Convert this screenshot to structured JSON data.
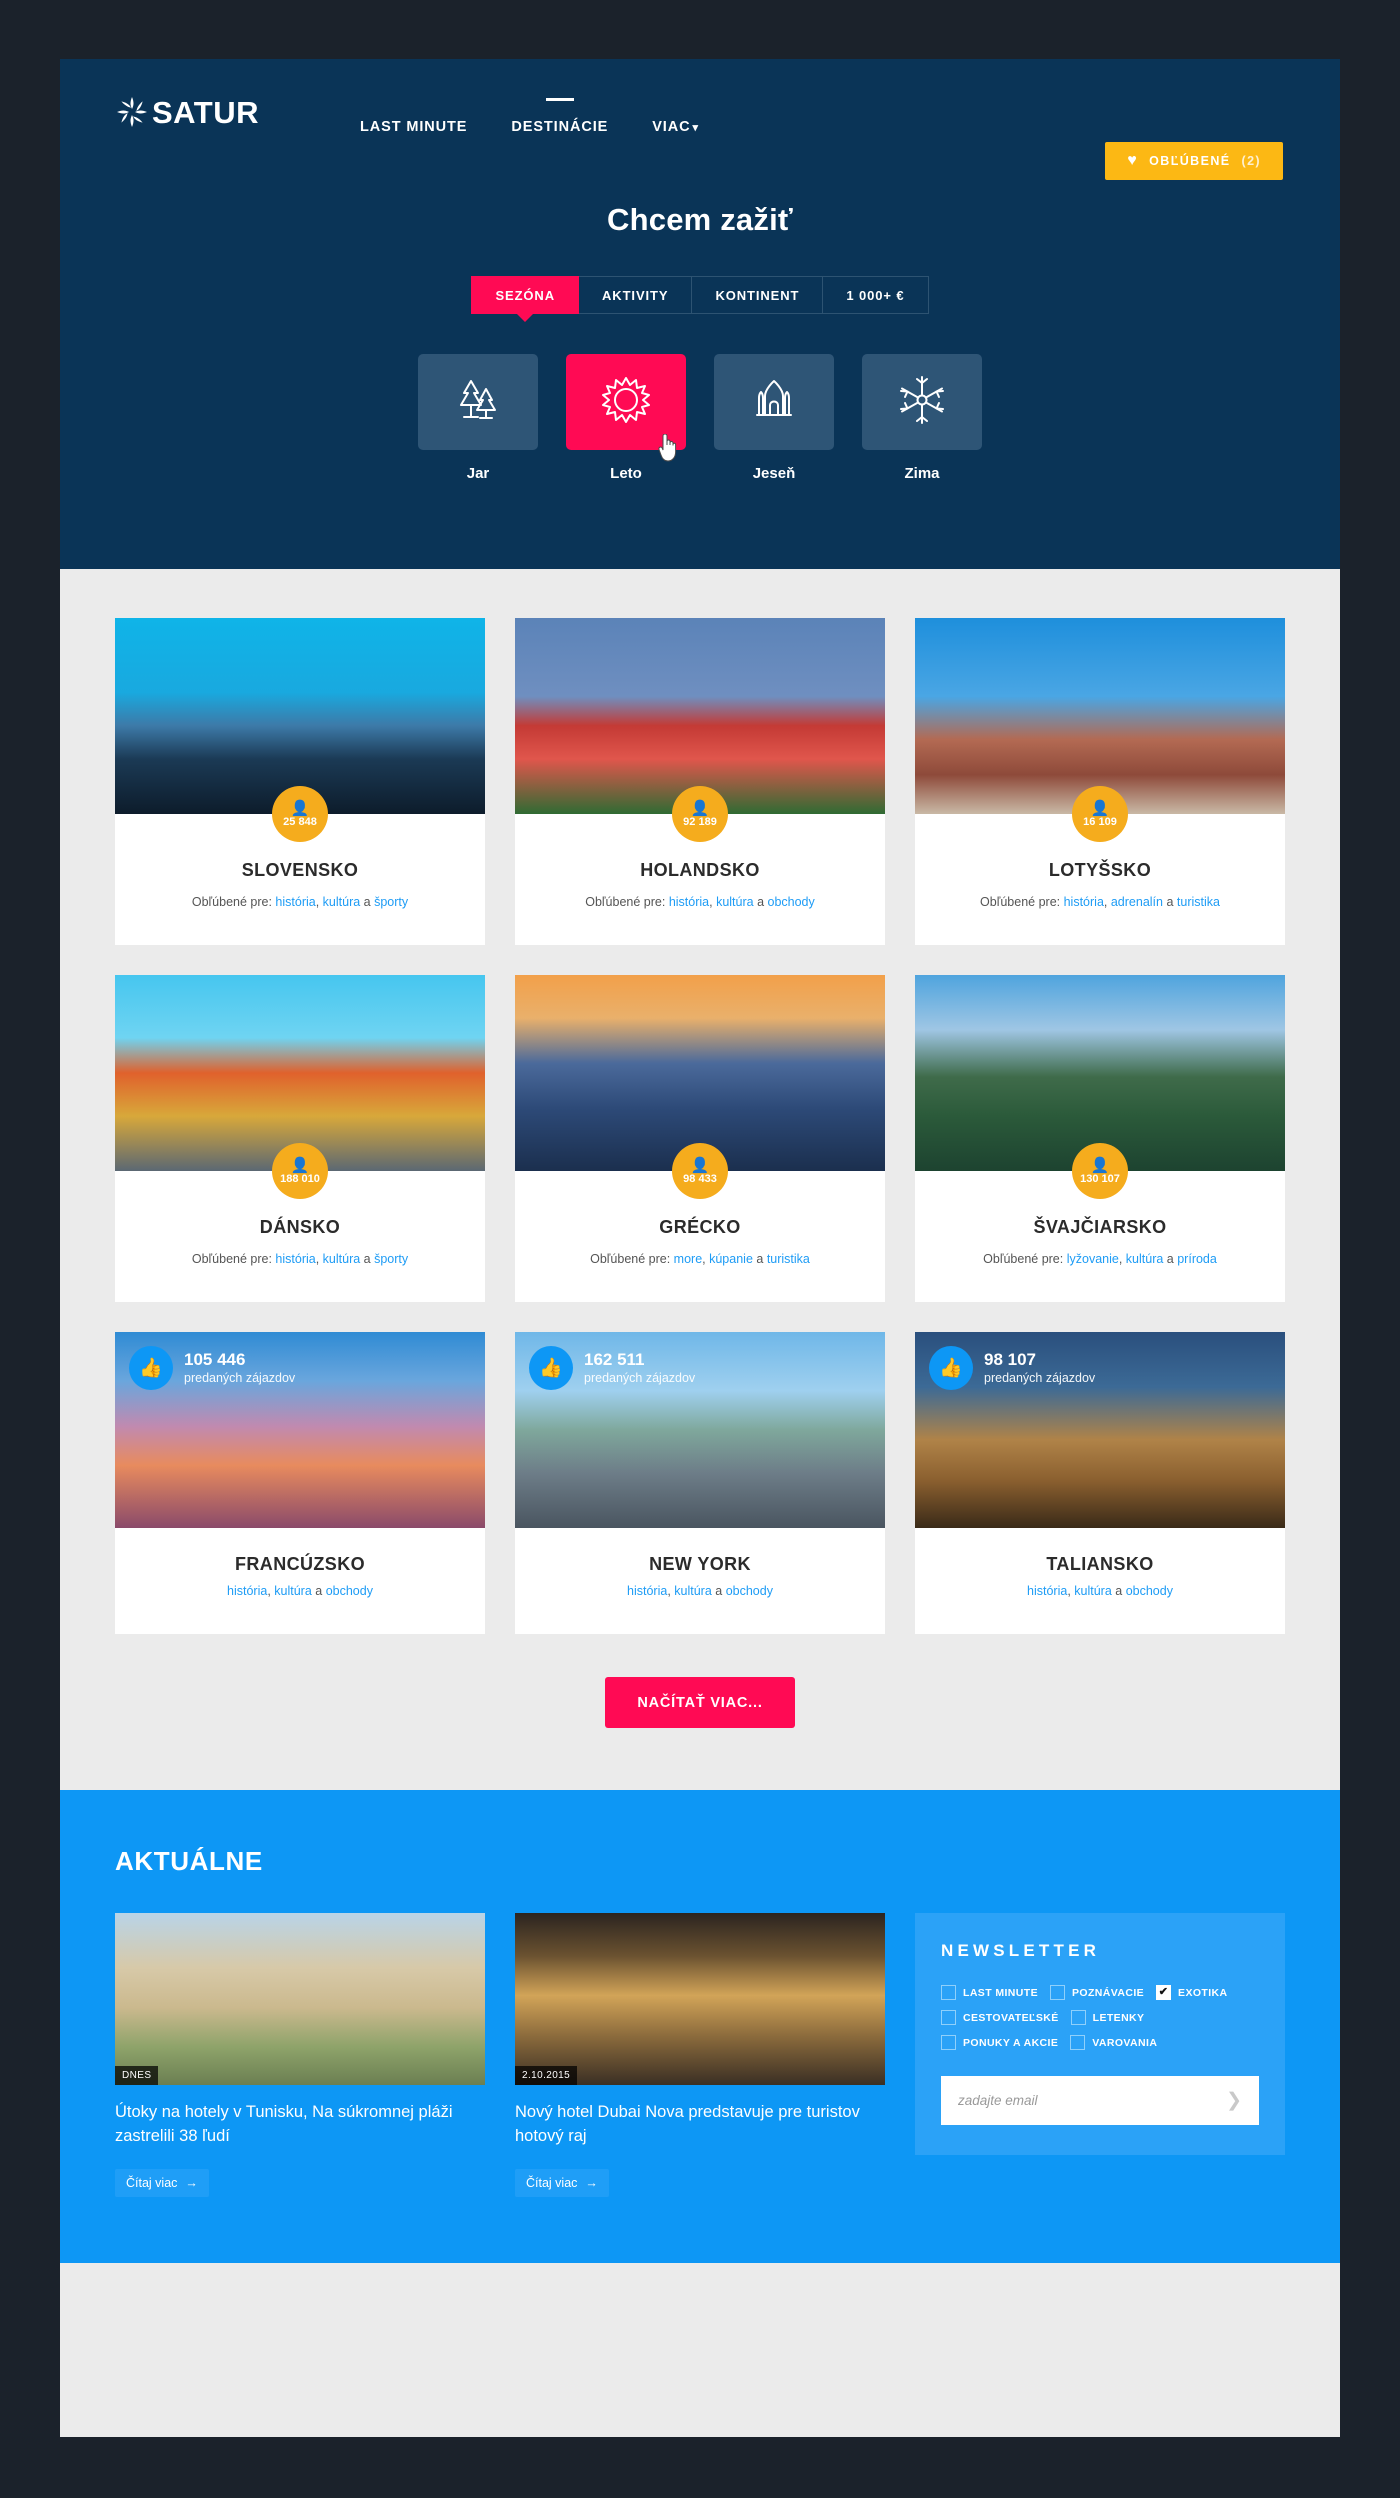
{
  "header": {
    "brand": "SATUR",
    "nav": [
      {
        "label": "LAST MINUTE",
        "active": false
      },
      {
        "label": "DESTINÁCIE",
        "active": true
      },
      {
        "label": "VIAC",
        "active": false,
        "caret": "⌄"
      }
    ],
    "favorites": {
      "label": "OBĽÚBENÉ",
      "count": "(2)",
      "icon": "heart-icon",
      "color": "#fcb814"
    }
  },
  "hero": {
    "title": "Chcem zažiť",
    "bg_color": "#0a3457",
    "accent_color": "#ff0a54",
    "tabs": [
      {
        "label": "SEZÓNA",
        "active": true
      },
      {
        "label": "AKTIVITY",
        "active": false
      },
      {
        "label": "KONTINENT",
        "active": false
      },
      {
        "label": "1 000+ €",
        "active": false
      }
    ],
    "seasons": [
      {
        "label": "Jar",
        "icon": "trees-icon",
        "active": false
      },
      {
        "label": "Leto",
        "icon": "sun-icon",
        "active": true
      },
      {
        "label": "Jeseň",
        "icon": "mosque-icon",
        "active": false
      },
      {
        "label": "Zima",
        "icon": "snowflake-icon",
        "active": false
      }
    ]
  },
  "destinations": [
    {
      "name": "SLOVENSKO",
      "badge_type": "people",
      "count": "25 848",
      "prefix": "Obľúbené pre: ",
      "tags": [
        "história",
        "kultúra",
        "športy"
      ],
      "img": "bratislava-castle"
    },
    {
      "name": "HOLANDSKO",
      "badge_type": "people",
      "count": "92 189",
      "prefix": "Obľúbené pre: ",
      "tags": [
        "história",
        "kultúra",
        "obchody"
      ],
      "img": "windmill-tulips"
    },
    {
      "name": "LOTYŠSKO",
      "badge_type": "people",
      "count": "16 109",
      "prefix": "Obľúbené pre: ",
      "tags": [
        "história",
        "adrenalín",
        "turistika"
      ],
      "img": "riga-houses"
    },
    {
      "name": "DÁNSKO",
      "badge_type": "people",
      "count": "188 010",
      "prefix": "Obľúbené pre: ",
      "tags": [
        "história",
        "kultúra",
        "športy"
      ],
      "img": "nyhavn-copenhagen"
    },
    {
      "name": "GRÉCKO",
      "badge_type": "people",
      "count": "98 433",
      "prefix": "Obľúbené pre: ",
      "tags": [
        "more",
        "kúpanie",
        "turistika"
      ],
      "img": "santorini-sunset"
    },
    {
      "name": "ŠVAJČIARSKO",
      "badge_type": "people",
      "count": "130 107",
      "prefix": "Obľúbené pre: ",
      "tags": [
        "lyžovanie",
        "kultúra",
        "príroda"
      ],
      "img": "mountain-lake"
    },
    {
      "name": "FRANCÚZSKO",
      "badge_type": "likes",
      "count": "105 446",
      "count_label": "predaných zájazdov",
      "prefix": "",
      "tags": [
        "história",
        "kultúra",
        "obchody"
      ],
      "img": "eiffel-tower-sunset"
    },
    {
      "name": "NEW YORK",
      "badge_type": "likes",
      "count": "162 511",
      "count_label": "predaných zájazdov",
      "prefix": "",
      "tags": [
        "história",
        "kultúra",
        "obchody"
      ],
      "img": "statue-of-liberty"
    },
    {
      "name": "TALIANSKO",
      "badge_type": "likes",
      "count": "98 107",
      "count_label": "predaných zájazdov",
      "prefix": "",
      "tags": [
        "história",
        "kultúra",
        "obchody"
      ],
      "img": "colosseum-night"
    }
  ],
  "load_more": {
    "label": "NAČÍTAŤ VIAC..."
  },
  "news": {
    "title": "AKTUÁLNE",
    "bg_color": "#0d97f5",
    "articles": [
      {
        "date": "DNES",
        "headline": "Útoky na hotely v Tunisku, Na súkromnej pláži zastrelili 38 ľudí",
        "read_more": "Čítaj viac",
        "img": "tunisia-hotel"
      },
      {
        "date": "2.10.2015",
        "headline": "Nový hotel Dubai Nova predstavuje pre turistov hotový raj",
        "read_more": "Čítaj viac",
        "img": "dubai-hotel-interior"
      }
    ],
    "newsletter": {
      "title": "NEWSLETTER",
      "options": [
        {
          "label": "LAST MINUTE",
          "checked": false
        },
        {
          "label": "POZNÁVACIE",
          "checked": false
        },
        {
          "label": "EXOTIKA",
          "checked": true
        },
        {
          "label": "CESTOVATEĽSKÉ",
          "checked": false
        },
        {
          "label": "LETENKY",
          "checked": false
        },
        {
          "label": "PONUKY A AKCIE",
          "checked": false
        },
        {
          "label": "VAROVANIA",
          "checked": false
        }
      ],
      "email_placeholder": "zadajte email",
      "email_value": "",
      "submit_icon": "chevron-right-icon"
    }
  }
}
